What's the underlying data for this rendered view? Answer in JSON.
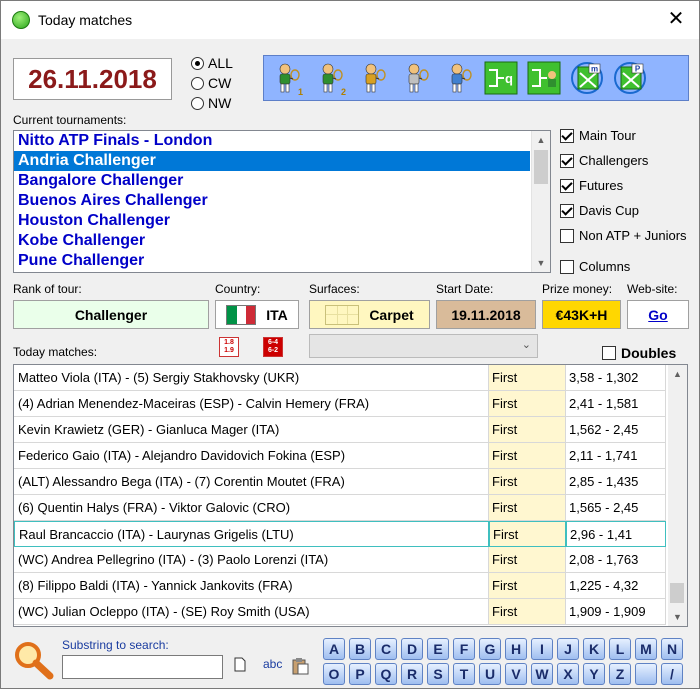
{
  "window": {
    "title": "Today matches",
    "close_glyph": "✕"
  },
  "date": "26.11.2018",
  "filters": {
    "radios": [
      {
        "label": "ALL",
        "checked": true
      },
      {
        "label": "CW",
        "checked": false
      },
      {
        "label": "NW",
        "checked": false
      }
    ]
  },
  "toolbar": {
    "buttons": [
      {
        "name": "player1-icon",
        "num": "1"
      },
      {
        "name": "player2-icon",
        "num": "2"
      },
      {
        "name": "referee-icon",
        "num": ""
      },
      {
        "name": "search-player-icon",
        "num": ""
      },
      {
        "name": "compare-players-icon",
        "num": ""
      },
      {
        "name": "qualifying-draw-icon",
        "num": ""
      },
      {
        "name": "main-draw-icon",
        "num": ""
      },
      {
        "name": "export-m-icon",
        "num": ""
      },
      {
        "name": "export-p-icon",
        "num": ""
      }
    ],
    "draw_letter": "q",
    "export_letters": [
      "m",
      "P"
    ]
  },
  "tournaments": {
    "label": "Current tournaments:",
    "items": [
      "Nitto ATP Finals - London",
      "Andria Challenger",
      "Bangalore Challenger",
      "Buenos Aires Challenger",
      "Houston Challenger",
      "Kobe Challenger",
      "Pune Challenger"
    ],
    "selected_index": 1
  },
  "tour_filters": [
    {
      "label": "Main Tour",
      "checked": true
    },
    {
      "label": "Challengers",
      "checked": true
    },
    {
      "label": "Futures",
      "checked": true
    },
    {
      "label": "Davis Cup",
      "checked": true
    },
    {
      "label": "Non ATP + Juniors",
      "checked": false
    }
  ],
  "columns_option": {
    "label": "Columns",
    "checked": false
  },
  "info": {
    "rank_label": "Rank of tour:",
    "rank_value": "Challenger",
    "country_label": "Country:",
    "country_value": "ITA",
    "flag_colors": [
      "#009246",
      "#ffffff",
      "#ce2b37"
    ],
    "surfaces_label": "Surfaces:",
    "surface_value": "Carpet",
    "start_label": "Start Date:",
    "start_value": "19.11.2018",
    "prize_label": "Prize money:",
    "prize_value": "€43K+H",
    "web_label": "Web-site:",
    "web_value": "Go"
  },
  "today": {
    "label": "Today matches:",
    "sort1": [
      "1.8",
      "1.9"
    ],
    "sort2": [
      "6-4",
      "6-2"
    ],
    "doubles_label": "Doubles",
    "doubles_checked": false,
    "rows": [
      {
        "match": "Matteo Viola (ITA) - (5) Sergiy Stakhovsky (UKR)",
        "round": "First",
        "odds": "3,58 - 1,302"
      },
      {
        "match": "(4) Adrian Menendez-Maceiras (ESP) - Calvin Hemery (FRA)",
        "round": "First",
        "odds": "2,41 - 1,581"
      },
      {
        "match": "Kevin Krawietz (GER) - Gianluca Mager (ITA)",
        "round": "First",
        "odds": "1,562 - 2,45"
      },
      {
        "match": "Federico Gaio (ITA) - Alejandro Davidovich Fokina (ESP)",
        "round": "First",
        "odds": "2,11 - 1,741"
      },
      {
        "match": "(ALT) Alessandro Bega (ITA) - (7) Corentin Moutet (FRA)",
        "round": "First",
        "odds": "2,85 - 1,435"
      },
      {
        "match": "(6) Quentin Halys (FRA) - Viktor Galovic (CRO)",
        "round": "First",
        "odds": "1,565 - 2,45"
      },
      {
        "match": "Raul Brancaccio (ITA) - Laurynas Grigelis (LTU)",
        "round": "First",
        "odds": "2,96 - 1,41"
      },
      {
        "match": "(WC) Andrea Pellegrino (ITA) - (3) Paolo Lorenzi (ITA)",
        "round": "First",
        "odds": "2,08 - 1,763"
      },
      {
        "match": "(8) Filippo Baldi (ITA) - Yannick Jankovits (FRA)",
        "round": "First",
        "odds": "1,225 - 4,32"
      },
      {
        "match": "(WC) Julian Ocleppo (ITA) - (SE) Roy Smith (USA)",
        "round": "First",
        "odds": "1,909 - 1,909"
      }
    ],
    "selected_index": 6
  },
  "search": {
    "label": "Substring to search:",
    "value": "",
    "abc_label": "abc"
  },
  "letters": [
    "A",
    "B",
    "C",
    "D",
    "E",
    "F",
    "G",
    "H",
    "I",
    "J",
    "K",
    "L",
    "M",
    "N",
    "O",
    "P",
    "Q",
    "R",
    "S",
    "T",
    "U",
    "V",
    "W",
    "X",
    "Y",
    "Z",
    "",
    "/"
  ]
}
